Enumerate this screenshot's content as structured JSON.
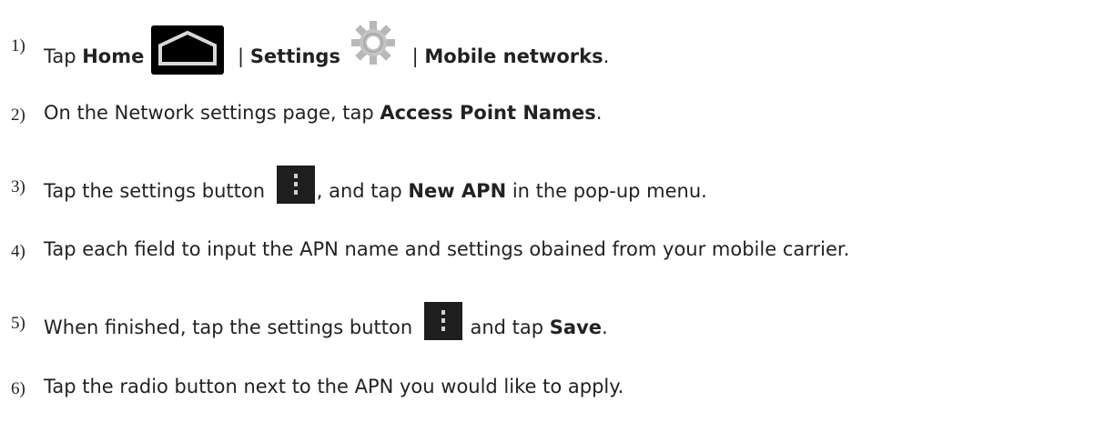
{
  "steps": [
    {
      "number": "1)",
      "parts": [
        "Tap ",
        "Home",
        " | ",
        "Settings",
        " | ",
        "Mobile networks",
        "."
      ]
    },
    {
      "number": "2)",
      "parts": [
        "On the Network settings page, tap ",
        "Access Point Names",
        "."
      ]
    },
    {
      "number": "3)",
      "parts": [
        "Tap the settings button ",
        ", and tap ",
        "New APN",
        " in the pop-up menu."
      ]
    },
    {
      "number": "4)",
      "parts": [
        "Tap each field to input the APN name and settings obained from your mobile carrier."
      ]
    },
    {
      "number": "5)",
      "parts": [
        "When finished, tap the settings button ",
        " and tap ",
        "Save",
        "."
      ]
    },
    {
      "number": "6)",
      "parts": [
        "Tap the radio button next to the APN you would like to apply."
      ]
    }
  ],
  "icons": {
    "home": "home-icon",
    "settings": "gear-icon",
    "menu": "menu-overflow-icon"
  }
}
